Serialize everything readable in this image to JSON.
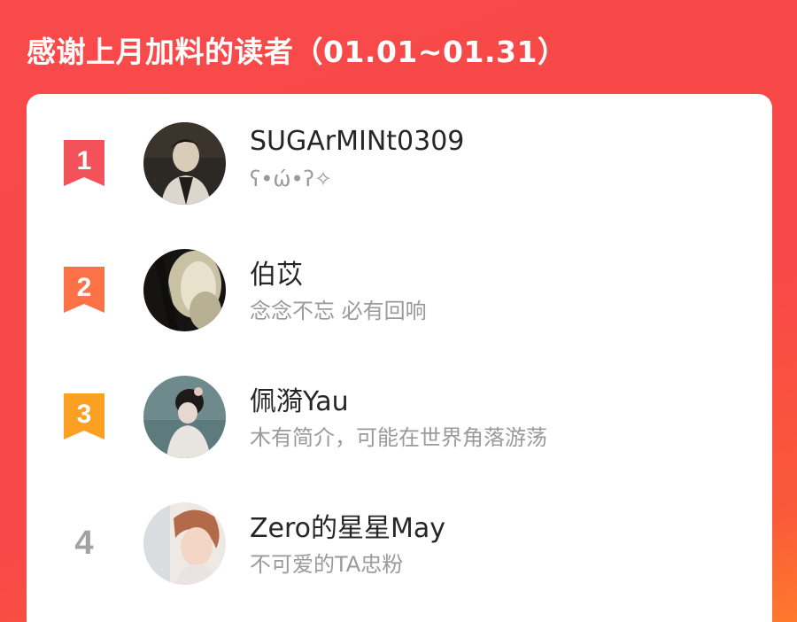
{
  "header": {
    "title": "感谢上月加料的读者（01.01~01.31）"
  },
  "colors": {
    "background": "#f84a4a",
    "rank1": "#f4525a",
    "rank2": "#fb7246",
    "rank3": "#fca024",
    "rank_plain": "#a2a2a2",
    "name_text": "#262626",
    "bio_text": "#9a9a9a"
  },
  "readers": [
    {
      "rank": "1",
      "name": "SUGArMINt0309",
      "bio": "ʕ•ώ•ʔ✧"
    },
    {
      "rank": "2",
      "name": "伯苡",
      "bio": "念念不忘 必有回响"
    },
    {
      "rank": "3",
      "name": "佩漪Yau",
      "bio": "木有简介，可能在世界角落游荡"
    },
    {
      "rank": "4",
      "name": "Zero的星星May",
      "bio": "不可爱的TA忠粉"
    }
  ]
}
